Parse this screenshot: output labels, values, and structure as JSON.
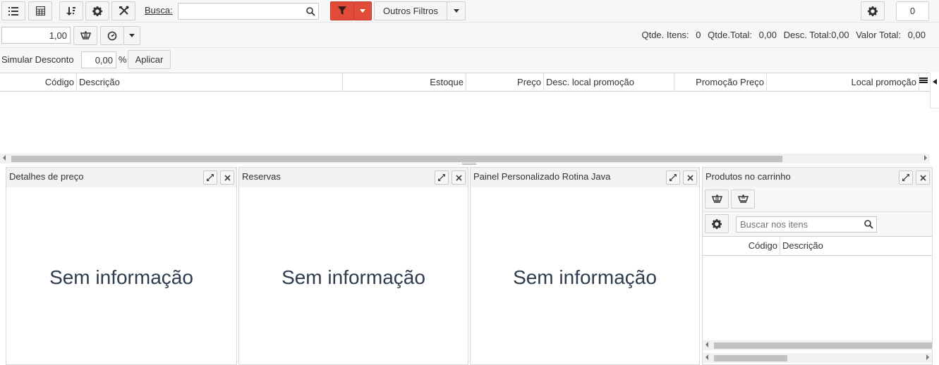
{
  "toolbar": {
    "busca_label": "Busca:",
    "busca_value": "",
    "outros_filtros_label": "Outros Filtros",
    "counter_value": "0"
  },
  "row2": {
    "quantity_value": "1,00",
    "totals": {
      "qtde_itens_label": "Qtde. Itens:",
      "qtde_itens_value": "0",
      "qtde_total_label": "Qtde.Total:",
      "qtde_total_value": "0,00",
      "desc_total_label": "Desc. Total:",
      "desc_total_value": "0,00",
      "valor_total_label": "Valor Total:",
      "valor_total_value": "0,00"
    }
  },
  "row3": {
    "simular_label": "Simular Desconto",
    "desconto_value": "0,00",
    "percent_symbol": "%",
    "aplicar_label": "Aplicar"
  },
  "grid": {
    "columns": [
      "Código",
      "Descrição",
      "Estoque",
      "Preço",
      "Desc. local promoção",
      "Promoção Preço",
      "Local promoção"
    ]
  },
  "panels": {
    "detalhes": {
      "title": "Detalhes de preço",
      "empty_text": "Sem informação"
    },
    "reservas": {
      "title": "Reservas",
      "empty_text": "Sem informação"
    },
    "painel_java": {
      "title": "Painel Personalizado Rotina Java",
      "empty_text": "Sem informação"
    },
    "carrinho": {
      "title": "Produtos no carrinho",
      "search_placeholder": "Buscar nos itens",
      "columns": [
        "Código",
        "Descrição"
      ]
    }
  },
  "colors": {
    "filter_red": "#e04b3a",
    "filter_red_dark": "#c73a2b"
  }
}
